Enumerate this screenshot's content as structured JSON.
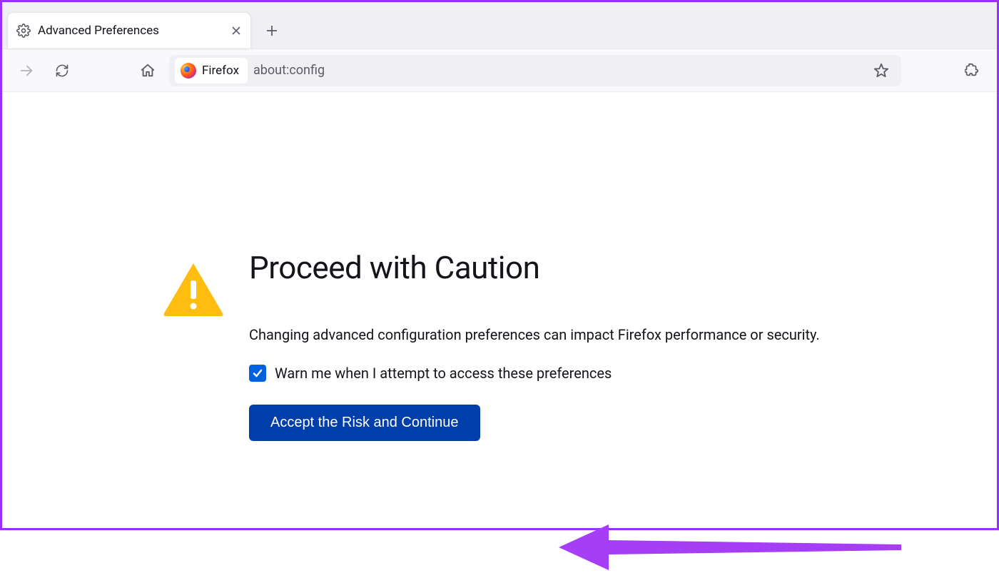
{
  "tab": {
    "title": "Advanced Preferences"
  },
  "toolbar": {
    "identity_label": "Firefox",
    "url": "about:config"
  },
  "warning": {
    "title": "Proceed with Caution",
    "description": "Changing advanced configuration preferences can impact Firefox performance or security.",
    "checkbox_label": "Warn me when I attempt to access these preferences",
    "checkbox_checked": true,
    "accept_label": "Accept the Risk and Continue"
  },
  "colors": {
    "accent_blue": "#003eaa",
    "warning_yellow": "#ffbd11",
    "annotation_purple": "#a63ef5"
  }
}
